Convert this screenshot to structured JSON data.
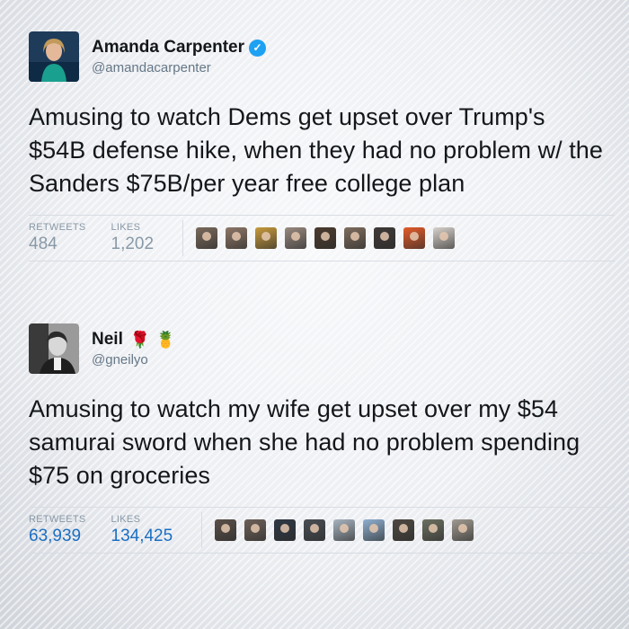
{
  "tweets": [
    {
      "name": "Amanda Carpenter",
      "handle": "@amandacarpenter",
      "text": "Amusing to watch Dems get upset over Trump's $54B defense hike, when they had no problem w/ the Sanders $75B/per year free college plan",
      "retweets_label": "RETWEETS",
      "retweets": "484",
      "likes_label": "LIKES",
      "likes": "1,202",
      "liker_colors": [
        "#7a6a5c",
        "#8d7768",
        "#c89b3c",
        "#9a8a80",
        "#4b3b2e",
        "#7e6d5e",
        "#3f3a38",
        "#e35b2a",
        "#d8d2cc"
      ]
    },
    {
      "name": "Neil",
      "emoji_1": "🌹",
      "emoji_2": "🍍",
      "handle": "@gneilyo",
      "text": "Amusing to watch my wife get upset over my $54 samurai sword when she had no problem spending $75 on groceries",
      "retweets_label": "RETWEETS",
      "retweets": "63,939",
      "likes_label": "LIKES",
      "likes": "134,425",
      "liker_colors": [
        "#5a5048",
        "#6d6158",
        "#2e3844",
        "#4a4f54",
        "#a8b4c0",
        "#8fb0d0",
        "#4e4840",
        "#6b7060",
        "#a09a90"
      ]
    }
  ],
  "colors": {
    "verified": "#1da1f2",
    "stat_muted": "#8899a6",
    "stat_link": "#1b6ec2"
  }
}
